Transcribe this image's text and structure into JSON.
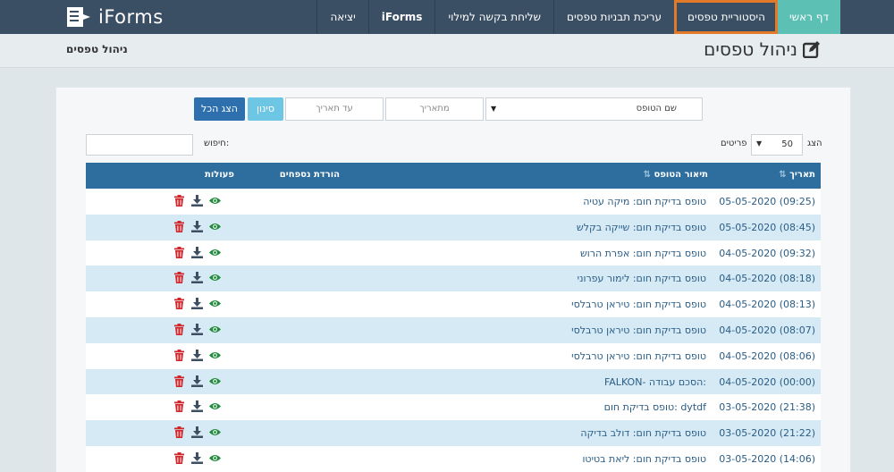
{
  "nav": {
    "logo_text": "iForms",
    "items": [
      {
        "label": "דף ראשי"
      },
      {
        "label": "היסטוריית טפסים"
      },
      {
        "label": "עריכת תבניות טפסים"
      },
      {
        "label": "שליחת בקשה למילוי"
      },
      {
        "label": "iForms"
      },
      {
        "label": "יציאה"
      }
    ]
  },
  "breadcrumb": "ניהול טפסים",
  "page_title": "ניהול טפסים",
  "filters": {
    "show_all_label": "הצג הכל",
    "filter_label": "סינון",
    "to_date_placeholder": "עד תאריך",
    "from_date_placeholder": "מתאריך",
    "template_placeholder": "שם הטופס"
  },
  "controls": {
    "search_label": "חיפוש:",
    "show_label": "הצג",
    "page_size": "50",
    "rows_label": "פריטים"
  },
  "table": {
    "headers": {
      "date": "תאריך",
      "description": "תיאור הטופס",
      "attachments": "הורדת נספחים",
      "actions": "פעולות"
    },
    "rows": [
      {
        "date": "05-05-2020 (09:25)",
        "description": "טופס בדיקת חום: מיקה עטיה"
      },
      {
        "date": "05-05-2020 (08:45)",
        "description": "טופס בדיקת חום: שייקה בקלש"
      },
      {
        "date": "04-05-2020 (09:32)",
        "description": "טופס בדיקת חום: אפרת הרוש"
      },
      {
        "date": "04-05-2020 (08:18)",
        "description": "טופס בדיקת חום: לימור עפרוני"
      },
      {
        "date": "04-05-2020 (08:13)",
        "description": "טופס בדיקת חום: טיראן טרבלסי"
      },
      {
        "date": "04-05-2020 (08:07)",
        "description": "טופס בדיקת חום: טיראן טרבלסי"
      },
      {
        "date": "04-05-2020 (08:06)",
        "description": "טופס בדיקת חום: טיראן טרבלסי"
      },
      {
        "date": "04-05-2020 (00:00)",
        "description": "FALKON- הסכם עבודה:"
      },
      {
        "date": "03-05-2020 (21:38)",
        "description": "טופס בדיקת חום: dytdf"
      },
      {
        "date": "03-05-2020 (21:22)",
        "description": "טופס בדיקת חום: דולב בדיקה"
      },
      {
        "date": "03-05-2020 (14:06)",
        "description": "טופס בדיקת חום: ליאת בטיטו"
      }
    ]
  },
  "colors": {
    "nav_bg": "#3b4f64",
    "home_accent": "#5cc0b5",
    "highlight_outline": "#e37a2a",
    "table_header": "#2e6e9e",
    "row_alt": "#d6eaf5",
    "view_icon": "#1f8a3b",
    "download_icon": "#3d4f63",
    "delete_icon": "#d0262b"
  },
  "icons": {
    "view": "eye-icon",
    "download": "download-icon",
    "delete": "trash-icon"
  }
}
